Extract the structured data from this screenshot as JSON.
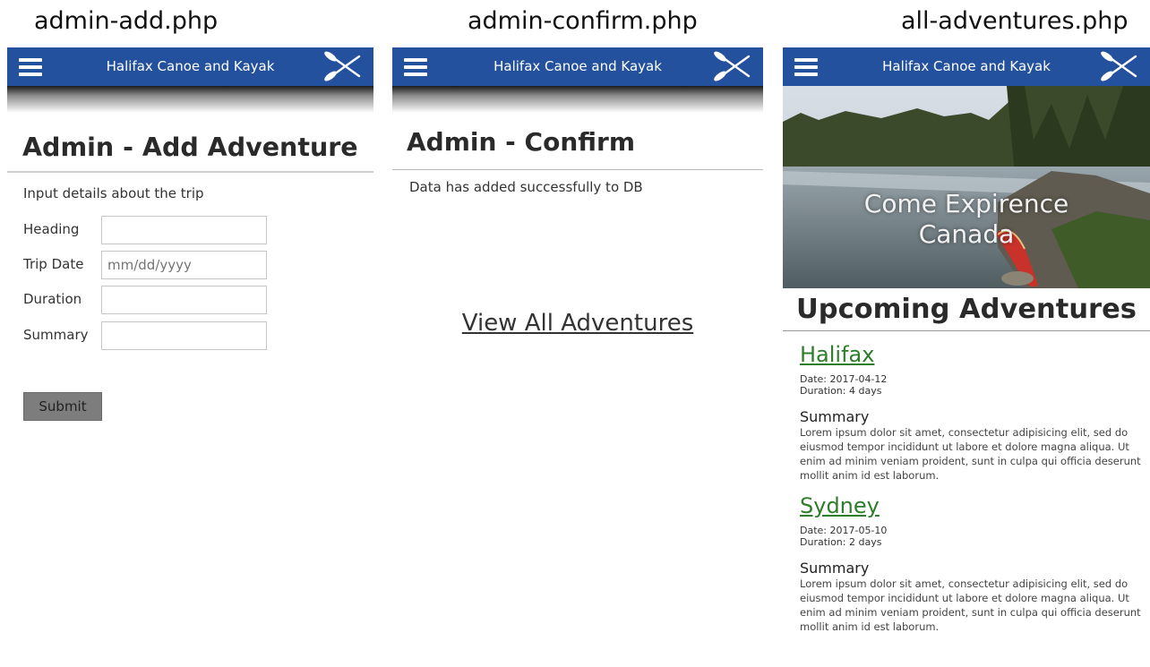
{
  "captions": [
    "admin-add.php",
    "admin-confirm.php",
    "all-adventures.php"
  ],
  "nav": {
    "title": "Halifax Canoe and Kayak",
    "menu_icon": "hamburger-menu-icon",
    "logo_icon": "crossed-paddles-icon",
    "color": "#24519e"
  },
  "admin_add": {
    "title": "Admin - Add Adventure",
    "intro": "Input details about the trip",
    "fields": [
      {
        "label": "Heading",
        "placeholder": ""
      },
      {
        "label": "Trip Date",
        "placeholder": "mm/dd/yyyy"
      },
      {
        "label": "Duration",
        "placeholder": ""
      },
      {
        "label": "Summary",
        "placeholder": ""
      }
    ],
    "submit_label": "Submit"
  },
  "admin_confirm": {
    "title": "Admin - Confirm",
    "message": "Data has added successfully to DB",
    "link_label": "View All Adventures"
  },
  "all_adventures": {
    "hero_line1": "Come Expirence",
    "hero_line2": "Canada",
    "title": "Upcoming Adventures",
    "trips": [
      {
        "name": "Halifax",
        "date": "Date: 2017-04-12",
        "duration": "Duration: 4 days",
        "summary_heading": "Summary",
        "summary": "Lorem ipsum dolor sit amet, consectetur adipisicing elit, sed do eiusmod tempor incididunt ut labore et dolore magna aliqua. Ut enim ad minim veniam proident, sunt in culpa qui officia deserunt mollit anim id est laborum."
      },
      {
        "name": "Sydney",
        "date": "Date: 2017-05-10",
        "duration": "Duration: 2 days",
        "summary_heading": "Summary",
        "summary": "Lorem ipsum dolor sit amet, consectetur adipisicing elit, sed do eiusmod tempor incididunt ut labore et dolore magna aliqua. Ut enim ad minim veniam proident, sunt in culpa qui officia deserunt mollit anim id est laborum."
      }
    ],
    "link_color": "#2e7d2a"
  }
}
